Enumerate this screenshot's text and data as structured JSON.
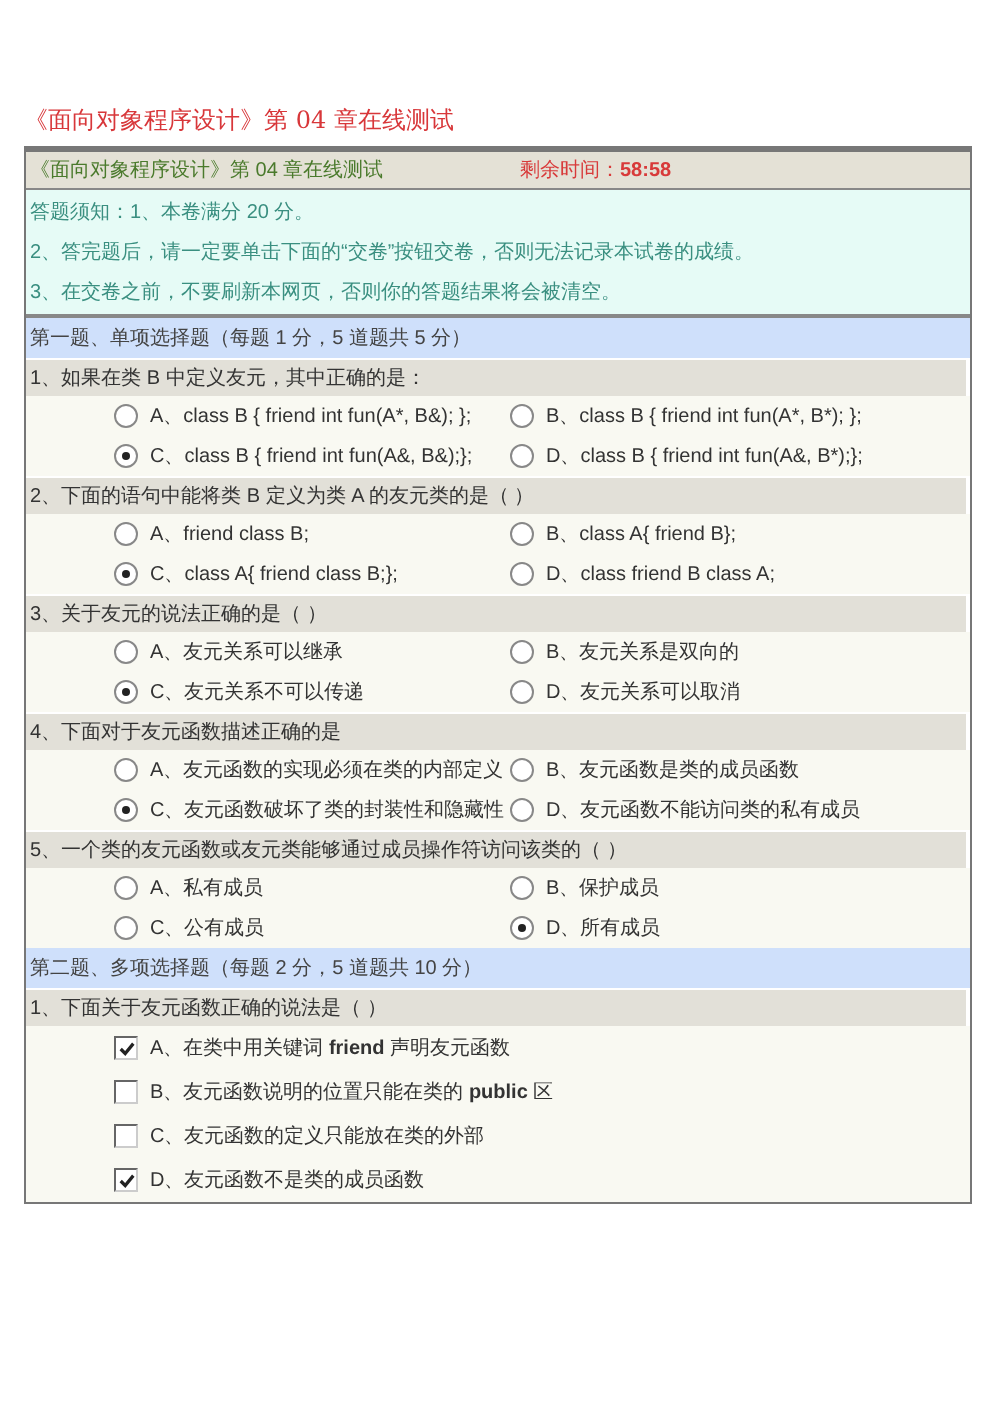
{
  "page_title": "《面向对象程序设计》第 04 章在线测试",
  "header": {
    "title": "《面向对象程序设计》第 04 章在线测试",
    "timer": "剩余时间：**58:58**"
  },
  "notes": [
    "答题须知：1、本卷满分 20 分。",
    "2、答完题后，请一定要单击下面的“交卷”按钮交卷，否则无法记录本试卷的成绩。",
    "3、在交卷之前，不要刷新本网页，否则你的答题结果将会被清空。"
  ],
  "sections": [
    {
      "title": "第一题、单项选择题（每题 1 分，5 道题共 5 分）",
      "questions": [
        {
          "text": "1、如果在类 B 中定义友元，其中正确的是：",
          "kind": "single",
          "options": [
            {
              "text": "A、class B { friend int fun(A*, B&); };",
              "selected": false
            },
            {
              "text": "B、class B { friend int fun(A*, B*); };",
              "selected": false
            },
            {
              "text": "C、class B { friend int fun(A&, B&);};",
              "selected": true
            },
            {
              "text": "D、class B { friend int fun(A&, B*);};",
              "selected": false
            }
          ]
        },
        {
          "text": "2、下面的语句中能将类 B 定义为类 A 的友元类的是（ ）",
          "kind": "single",
          "options": [
            {
              "text": "A、friend class B;",
              "selected": false
            },
            {
              "text": "B、class A{ friend B};",
              "selected": false
            },
            {
              "text": "C、class A{ friend class B;};",
              "selected": true
            },
            {
              "text": "D、class friend B class A;",
              "selected": false
            }
          ]
        },
        {
          "text": "3、关于友元的说法正确的是（ ）",
          "kind": "single",
          "options": [
            {
              "text": "A、友元关系可以继承",
              "selected": false
            },
            {
              "text": "B、友元关系是双向的",
              "selected": false
            },
            {
              "text": "C、友元关系不可以传递",
              "selected": true
            },
            {
              "text": "D、友元关系可以取消",
              "selected": false
            }
          ]
        },
        {
          "text": "4、下面对于友元函数描述正确的是",
          "kind": "single",
          "options": [
            {
              "text": "A、友元函数的实现必须在类的内部定义",
              "selected": false
            },
            {
              "text": "B、友元函数是类的成员函数",
              "selected": false
            },
            {
              "text": "C、友元函数破坏了类的封装性和隐藏性",
              "selected": true
            },
            {
              "text": "D、友元函数不能访问类的私有成员",
              "selected": false
            }
          ]
        },
        {
          "text": "5、一个类的友元函数或友元类能够通过成员操作符访问该类的（ ）",
          "kind": "single",
          "options": [
            {
              "text": "A、私有成员",
              "selected": false
            },
            {
              "text": "B、保护成员",
              "selected": false
            },
            {
              "text": "C、公有成员",
              "selected": false
            },
            {
              "text": "D、所有成员",
              "selected": true
            }
          ]
        }
      ]
    },
    {
      "title": "第二题、多项选择题（每题 2 分，5 道题共 10 分）",
      "questions": [
        {
          "text": "1、下面关于友元函数正确的说法是（ ）",
          "kind": "multi",
          "options": [
            {
              "text": "A、在类中用关键词 **friend** 声明友元函数",
              "checked": true
            },
            {
              "text": "B、友元函数说明的位置只能在类的 **public** 区",
              "checked": false
            },
            {
              "text": "C、友元函数的定义只能放在类的外部",
              "checked": false
            },
            {
              "text": "D、友元函数不是类的成员函数",
              "checked": true
            }
          ]
        }
      ]
    }
  ]
}
